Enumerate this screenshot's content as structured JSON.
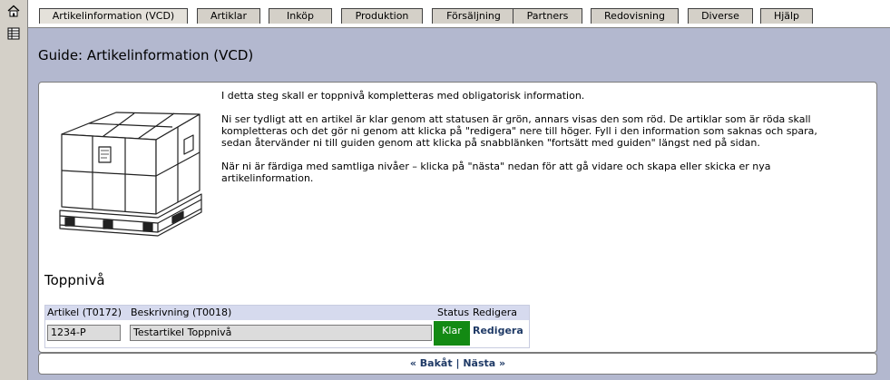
{
  "sidebar": {
    "icons": [
      "home-icon",
      "list-icon"
    ]
  },
  "tabs": [
    {
      "label": "Artikelinformation (VCD)",
      "active": true
    },
    {
      "label": "Artiklar"
    },
    {
      "label": "Inköp"
    },
    {
      "label": "Produktion"
    },
    {
      "label": "Försäljning"
    },
    {
      "label": "Partners"
    },
    {
      "label": "Redovisning"
    },
    {
      "label": "Diverse"
    },
    {
      "label": "Hjälp"
    }
  ],
  "page": {
    "title": "Guide: Artikelinformation (VCD)"
  },
  "intro": {
    "p1": "I detta steg skall er toppnivå kompletteras med obligatorisk information.",
    "p2a": "Ni ser tydligt att en artikel är klar genom att statusen är grön, annars visas den som röd. De artiklar som är röda skall",
    "p2b": "kompletteras och det gör ni genom att klicka på \"redigera\" nere till höger. Fyll i den information som saknas och spara,",
    "p2c": "sedan återvänder ni till guiden genom att klicka på snabblänken \"fortsätt med guiden\" längst ned på sidan.",
    "p3a": "När ni är färdiga med samtliga nivåer – klicka på \"nästa\" nedan för att gå vidare och skapa eller skicka er nya",
    "p3b": "artikelinformation."
  },
  "section": {
    "title": "Toppnivå"
  },
  "table": {
    "headers": {
      "article": "Artikel (T0172)",
      "description": "Beskrivning (T0018)",
      "status": "Status",
      "edit": "Redigera"
    },
    "row": {
      "article": "1234-P",
      "description": "Testartikel Toppnivå",
      "status": "Klar",
      "status_color": "#138a13",
      "edit": "Redigera"
    }
  },
  "nav": {
    "back": "« Bakåt",
    "separator": "|",
    "next": "Nästa »"
  },
  "colors": {
    "main_bg": "#b3b8cf",
    "link": "#1f3a66",
    "tab_bg": "#d4d0c8"
  }
}
